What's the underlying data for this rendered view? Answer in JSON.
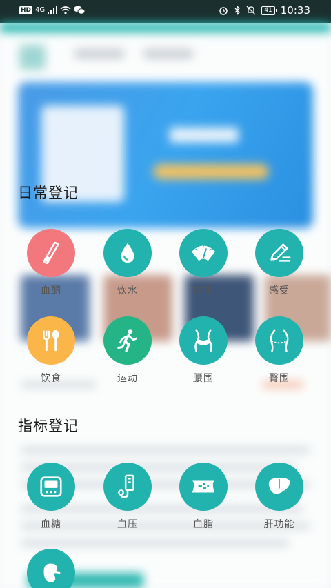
{
  "status_bar": {
    "left_badge": "HD",
    "network": "4G",
    "battery": "41",
    "time": "10:33"
  },
  "sections": {
    "daily": {
      "title": "日常登记",
      "items": [
        {
          "label": "血酮",
          "color": "#f2787e",
          "icon": "test-strip-icon"
        },
        {
          "label": "饮水",
          "color": "#22b3ae",
          "icon": "water-drop-icon"
        },
        {
          "label": "体重",
          "color": "#22b3ae",
          "icon": "scale-gauge-icon"
        },
        {
          "label": "感受",
          "color": "#22b3ae",
          "icon": "pencil-icon"
        },
        {
          "label": "饮食",
          "color": "#fbb64a",
          "icon": "fork-spoon-icon"
        },
        {
          "label": "运动",
          "color": "#25b485",
          "icon": "running-person-icon"
        },
        {
          "label": "腰围",
          "color": "#22b3ae",
          "icon": "waist-icon"
        },
        {
          "label": "臀围",
          "color": "#22b3ae",
          "icon": "hip-icon"
        }
      ]
    },
    "indicators": {
      "title": "指标登记",
      "items": [
        {
          "label": "血糖",
          "color": "#22b3ae",
          "icon": "glucose-meter-icon"
        },
        {
          "label": "血压",
          "color": "#22b3ae",
          "icon": "blood-pressure-icon"
        },
        {
          "label": "血脂",
          "color": "#22b3ae",
          "icon": "blood-lipid-icon"
        },
        {
          "label": "肝功能",
          "color": "#22b3ae",
          "icon": "liver-icon"
        },
        {
          "label": "",
          "color": "#22b3ae",
          "icon": "kidney-icon"
        }
      ]
    }
  }
}
